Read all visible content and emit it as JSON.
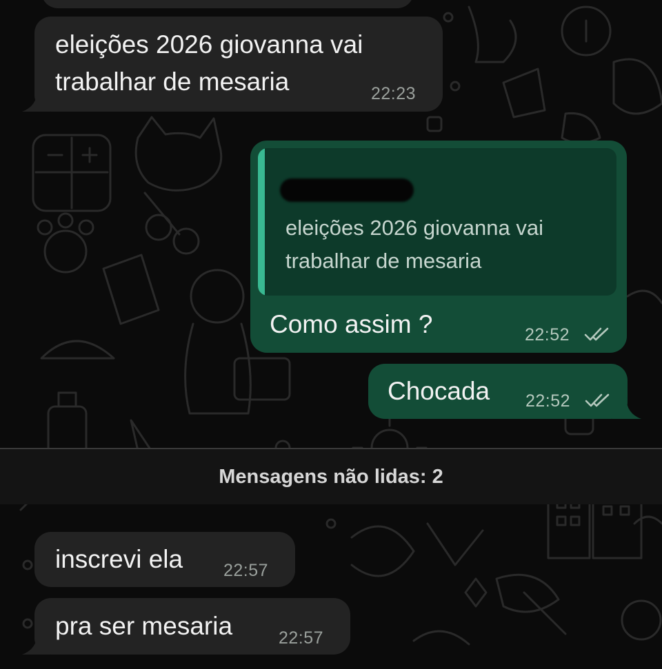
{
  "chat": {
    "messages": [
      {
        "direction": "incoming",
        "text": "eleições 2026 giovanna vai\ntrabalhar de mesaria",
        "time": "22:23"
      },
      {
        "direction": "outgoing",
        "reply_to": {
          "author": "[redacted]",
          "text": "eleições 2026 giovanna vai\ntrabalhar de mesaria"
        },
        "text": "Como assim ?",
        "time": "22:52",
        "status": "read"
      },
      {
        "direction": "outgoing",
        "text": "Chocada",
        "time": "22:52",
        "status": "read"
      },
      {
        "direction": "incoming",
        "text": "inscrevi ela",
        "time": "22:57"
      },
      {
        "direction": "incoming",
        "text": "pra ser mesaria",
        "time": "22:57"
      }
    ],
    "unread_divider": "Mensagens não lidas: 2"
  },
  "colors": {
    "background": "#0b0b0b",
    "incoming_bubble": "#232323",
    "outgoing_bubble": "#134d37",
    "quote_background": "#0d3a2a",
    "quote_accent": "#39b992",
    "read_ticks": "#b4c8bd"
  },
  "icons": [
    "double-check-icon",
    "wallpaper-doodle-pattern"
  ]
}
